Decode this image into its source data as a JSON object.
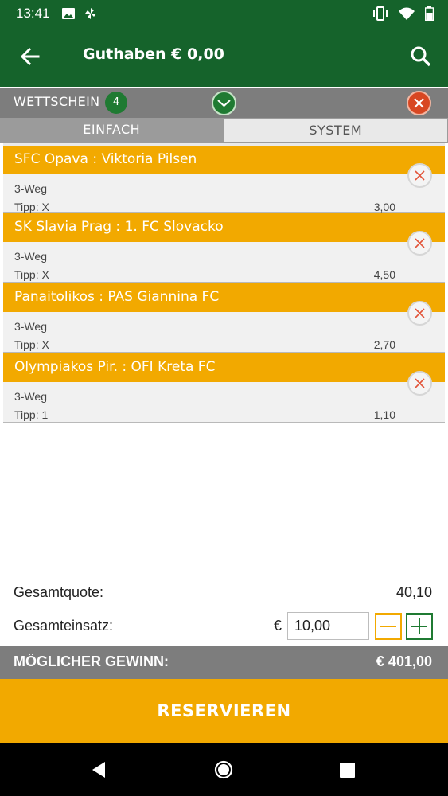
{
  "status_bar": {
    "time": "13:41",
    "icons": [
      "image-icon",
      "pinwheel-icon",
      "vibrate-icon",
      "wifi-icon",
      "battery-icon"
    ]
  },
  "app_bar": {
    "title": "Guthaben € 0,00",
    "back_icon": "arrow-left-icon",
    "search_icon": "search-icon"
  },
  "slip": {
    "label": "WETTSCHEIN",
    "count": "4"
  },
  "tabs": [
    {
      "label": "EINFACH",
      "active": true
    },
    {
      "label": "SYSTEM",
      "active": false
    }
  ],
  "bets": [
    {
      "match": "SFC Opava : Viktoria Pilsen",
      "market": "3-Weg",
      "tip": "Tipp: X",
      "odds": "3,00"
    },
    {
      "match": "SK Slavia Prag : 1. FC Slovacko",
      "market": "3-Weg",
      "tip": "Tipp: X",
      "odds": "4,50"
    },
    {
      "match": "Panaitolikos : PAS Giannina FC",
      "market": "3-Weg",
      "tip": "Tipp: X",
      "odds": "2,70"
    },
    {
      "match": "Olympiakos Pir. : OFI Kreta FC",
      "market": "3-Weg",
      "tip": "Tipp: 1",
      "odds": "1,10"
    }
  ],
  "summary": {
    "total_odds_label": "Gesamtquote:",
    "total_odds_value": "40,10",
    "stake_label": "Gesamteinsatz:",
    "currency": "€",
    "stake_value": "10,00",
    "win_label": "MÖGLICHER GEWINN:",
    "win_value": "€ 401,00"
  },
  "reserve_button": "RESERVIEREN",
  "colors": {
    "brand_green": "#15632b",
    "accent_orange": "#f2a900",
    "danger_red": "#d84722",
    "gray_bar": "#7d7d7d"
  }
}
